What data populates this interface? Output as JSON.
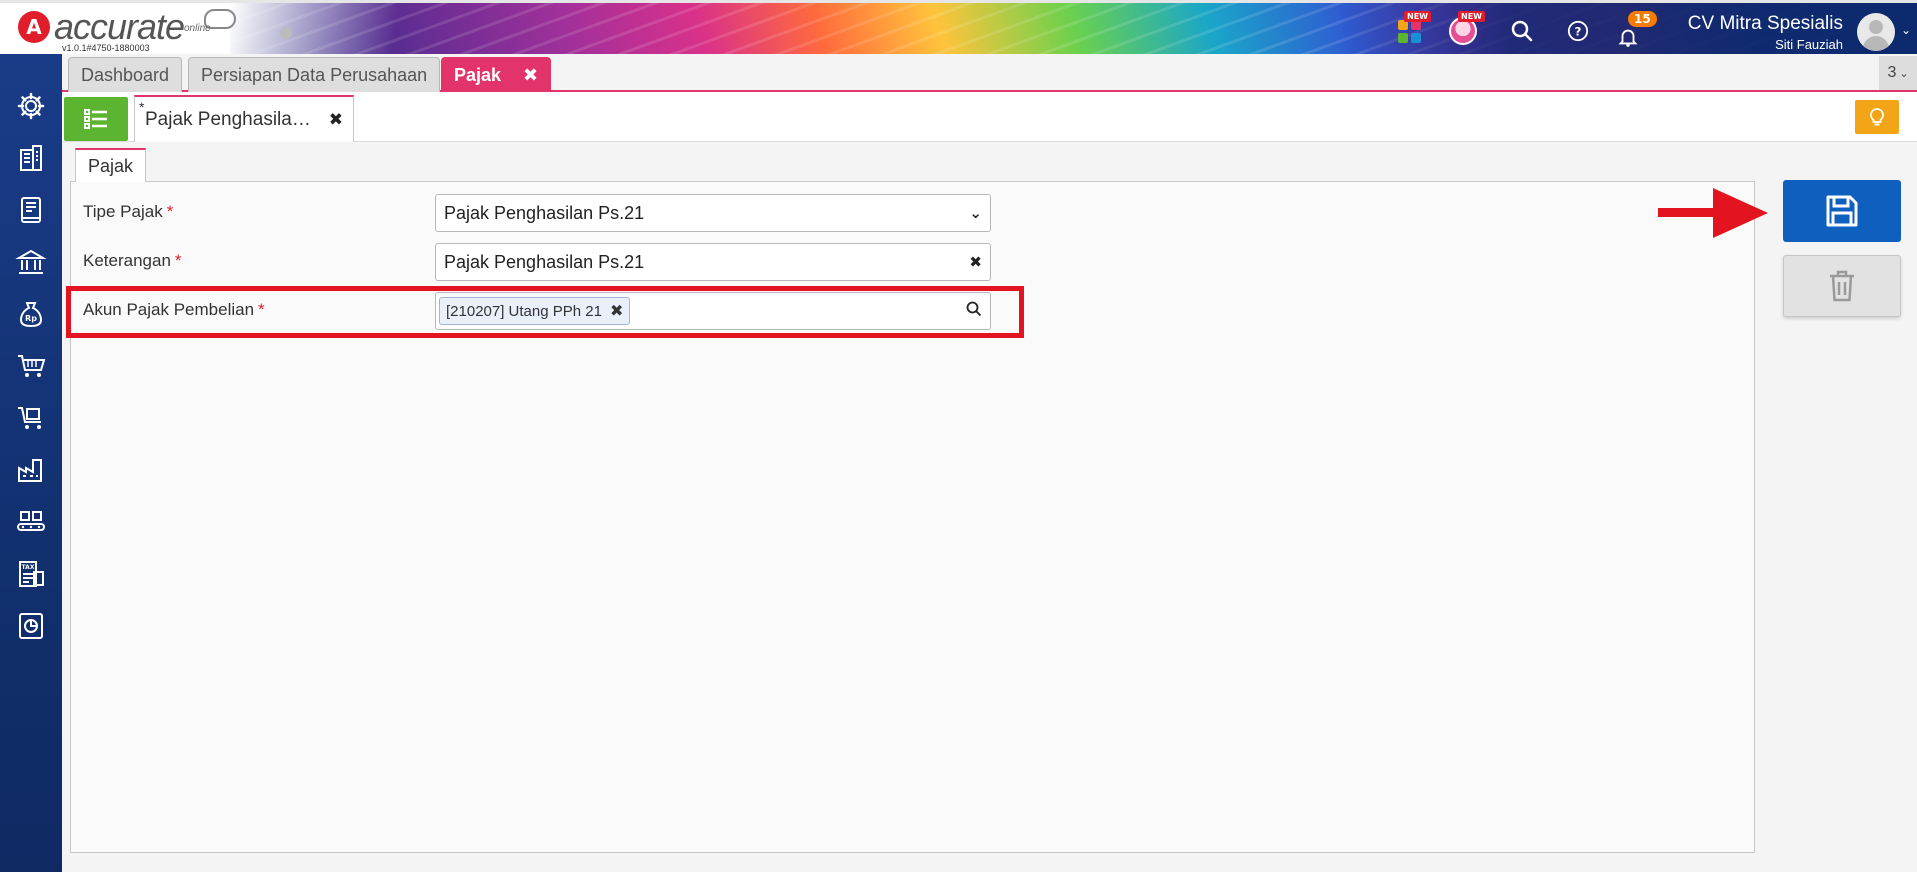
{
  "app": {
    "logo_text": "accurate",
    "logo_sub": "online",
    "version": "v1.0.1#4750-1880003"
  },
  "header": {
    "apps_badge": "NEW",
    "assistant_badge": "NEW",
    "notification_count": "15",
    "company_name": "CV Mitra Spesialis",
    "user_name": "Siti Fauziah"
  },
  "tabs": [
    {
      "label": "Dashboard"
    },
    {
      "label": "Persiapan Data Perusahaan"
    },
    {
      "label": "Pajak"
    }
  ],
  "tab_count": "3",
  "document_tab": {
    "modified_marker": "*",
    "label": "Pajak Penghasila…"
  },
  "inner_tab": "Pajak",
  "form": {
    "tipe_pajak": {
      "label": "Tipe Pajak",
      "required": "*",
      "value": "Pajak Penghasilan Ps.21"
    },
    "keterangan": {
      "label": "Keterangan",
      "required": "*",
      "value": "Pajak Penghasilan Ps.21"
    },
    "akun_pajak_pembelian": {
      "label": "Akun Pajak Pembelian",
      "required": "*",
      "chip": "[210207] Utang PPh 21"
    }
  },
  "colors": {
    "accent": "#e2336b",
    "save": "#0f5fbf",
    "menu": "#5cb531",
    "tip": "#f2a516",
    "highlight": "#e3141f",
    "sidebar": "#1a3c88"
  },
  "icons": [
    "gear-icon",
    "building-icon",
    "book-icon",
    "bank-icon",
    "money-bag-icon",
    "cart-icon",
    "cart-box-icon",
    "factory-icon",
    "conveyor-icon",
    "tax-icon",
    "report-icon",
    "search-icon",
    "help-icon",
    "bell-icon",
    "save-icon",
    "trash-icon",
    "lightbulb-icon",
    "list-icon"
  ]
}
